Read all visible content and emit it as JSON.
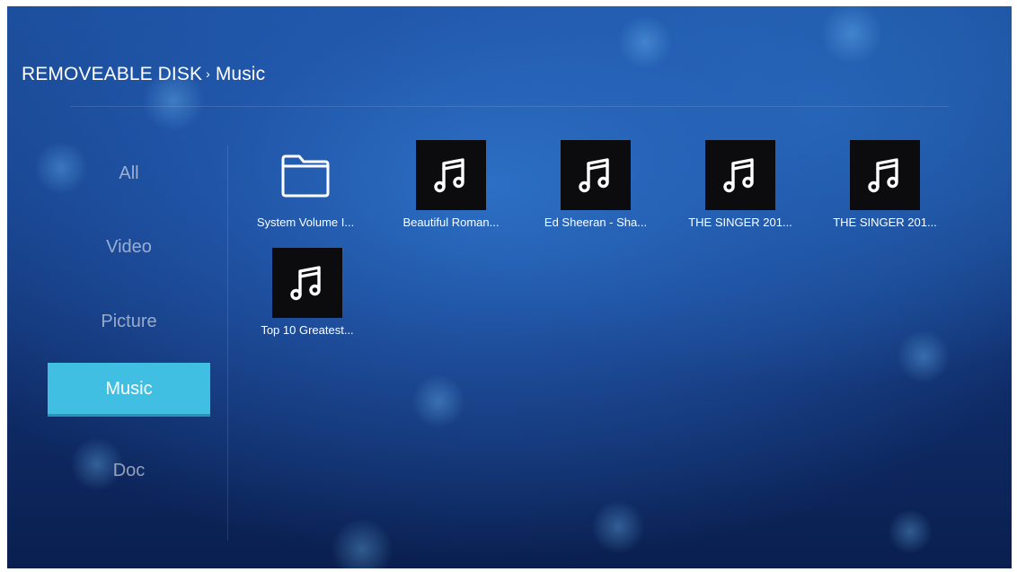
{
  "breadcrumb": {
    "root": "REMOVEABLE DISK",
    "separator": "›",
    "current": "Music"
  },
  "sidebar": {
    "items": [
      {
        "label": "All",
        "active": false
      },
      {
        "label": "Video",
        "active": false
      },
      {
        "label": "Picture",
        "active": false
      },
      {
        "label": "Music",
        "active": true
      },
      {
        "label": "Doc",
        "active": false
      }
    ]
  },
  "files": [
    {
      "name": "System Volume I...",
      "icon": "folder-icon"
    },
    {
      "name": "Beautiful Roman...",
      "icon": "music-note-icon"
    },
    {
      "name": "Ed Sheeran - Sha...",
      "icon": "music-note-icon"
    },
    {
      "name": "THE SINGER 201...",
      "icon": "music-note-icon"
    },
    {
      "name": "THE SINGER 201...",
      "icon": "music-note-icon"
    },
    {
      "name": "Top 10 Greatest...",
      "icon": "music-note-icon"
    }
  ],
  "colors": {
    "active_tab": "#41bfe3",
    "background_top": "#1b4d9a",
    "background_bottom": "#0a1f4f"
  }
}
